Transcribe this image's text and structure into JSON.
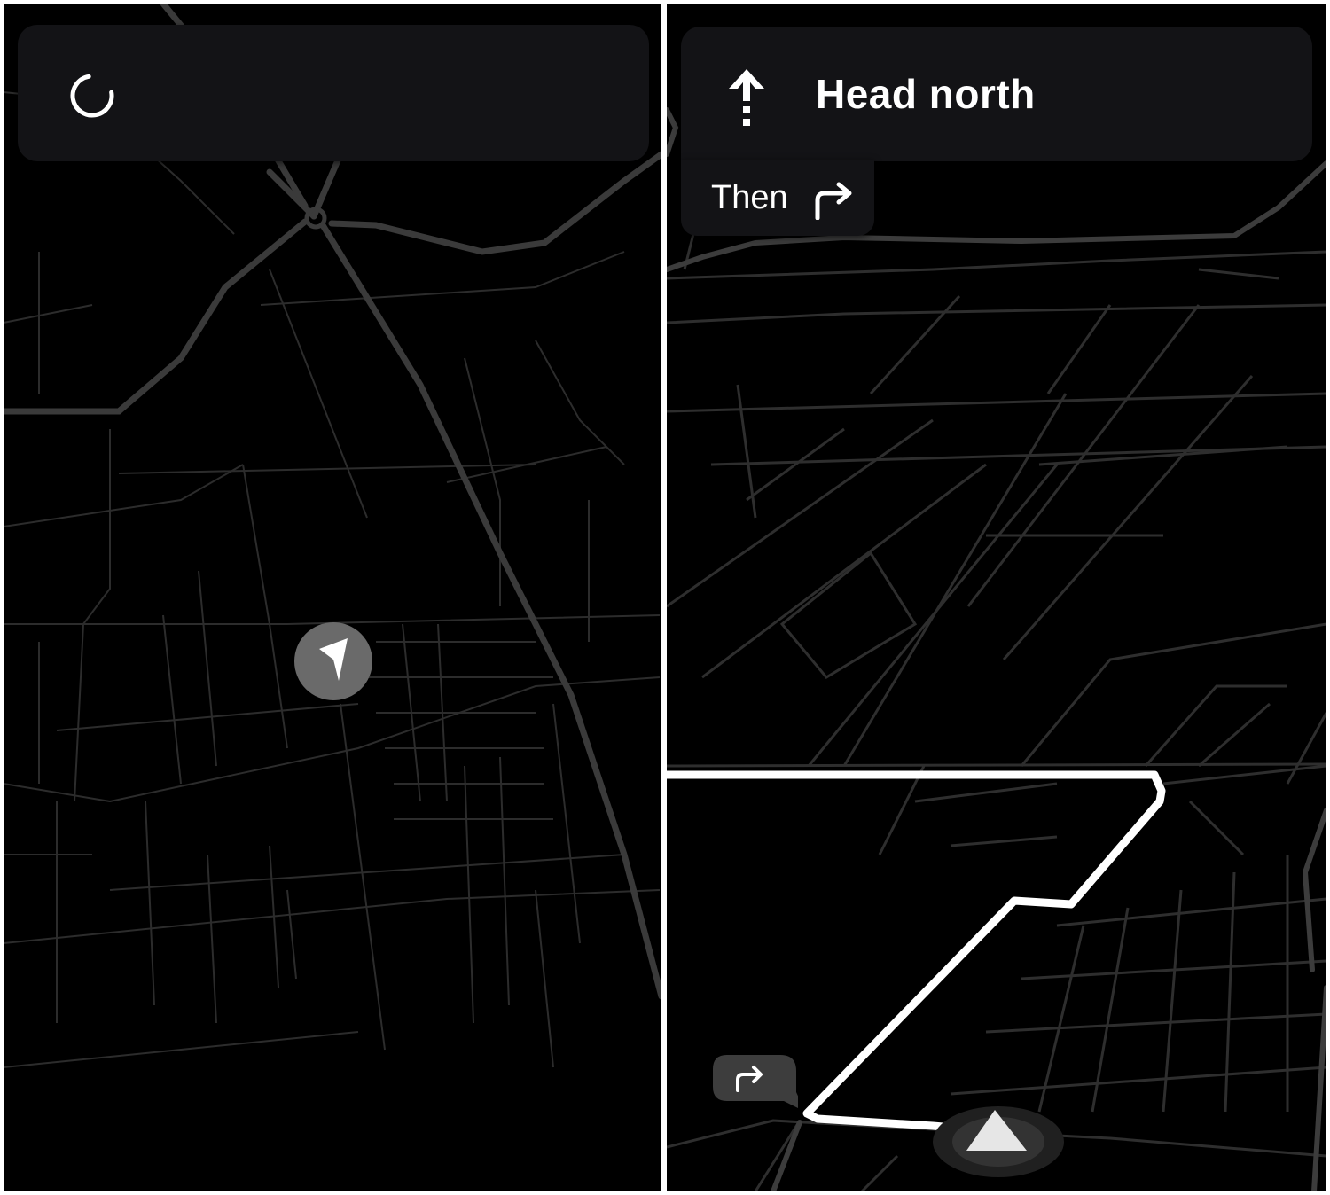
{
  "screens": {
    "left": {
      "status": "loading",
      "spinner_icon": "loading-spinner-icon",
      "location_icon": "navigation-arrow-icon"
    },
    "right": {
      "instruction": {
        "text": "Head north",
        "icon": "straight-arrow-icon"
      },
      "next_maneuver": {
        "label": "Then",
        "icon": "turn-right-icon"
      },
      "route_callout_icon": "turn-right-icon",
      "location_icon": "navigation-arrow-icon"
    }
  },
  "colors": {
    "map_background": "#000000",
    "minor_road": "#2f2f2f",
    "major_road": "#3c3c3c",
    "route_line": "#ffffff",
    "card_background": "#131316",
    "puck": "#6a6a6a"
  }
}
